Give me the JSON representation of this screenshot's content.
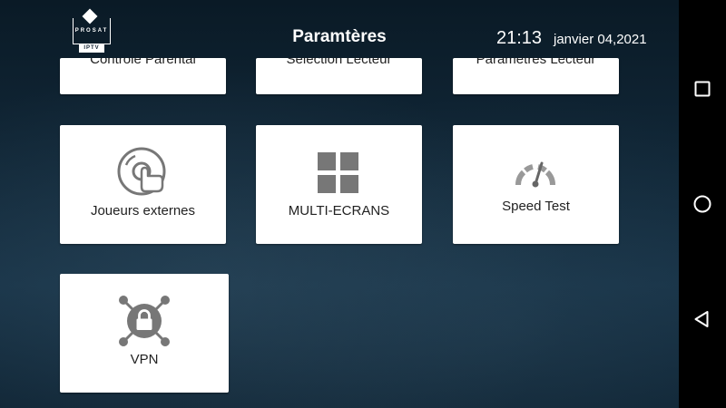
{
  "header": {
    "logo": {
      "brand": "PROSAT",
      "sub": "IPTV"
    },
    "title": "Paramtères",
    "time": "21:13",
    "date": "janvier 04,2021"
  },
  "tiles": {
    "parental": {
      "label": "Contrôle Parental"
    },
    "player_select": {
      "label": "Sélection Lecteur"
    },
    "player_settings": {
      "label": "Paramètres Lecteur"
    },
    "external_players": {
      "label": "Joueurs externes",
      "icon": "disc-hand-icon"
    },
    "multiscreen": {
      "label": "MULTI-ECRANS",
      "icon": "grid-icon"
    },
    "speed_test": {
      "label": "Speed Test",
      "icon": "speedometer-icon"
    },
    "vpn": {
      "label": "VPN",
      "icon": "lock-network-icon"
    }
  },
  "nav": {
    "recents": {
      "icon": "square-icon"
    },
    "home": {
      "icon": "circle-icon"
    },
    "back": {
      "icon": "triangle-back-icon"
    }
  },
  "colors": {
    "icon_gray": "#777777",
    "tile_bg": "#ffffff",
    "label_text": "#222222",
    "nav_bg": "#000000"
  }
}
